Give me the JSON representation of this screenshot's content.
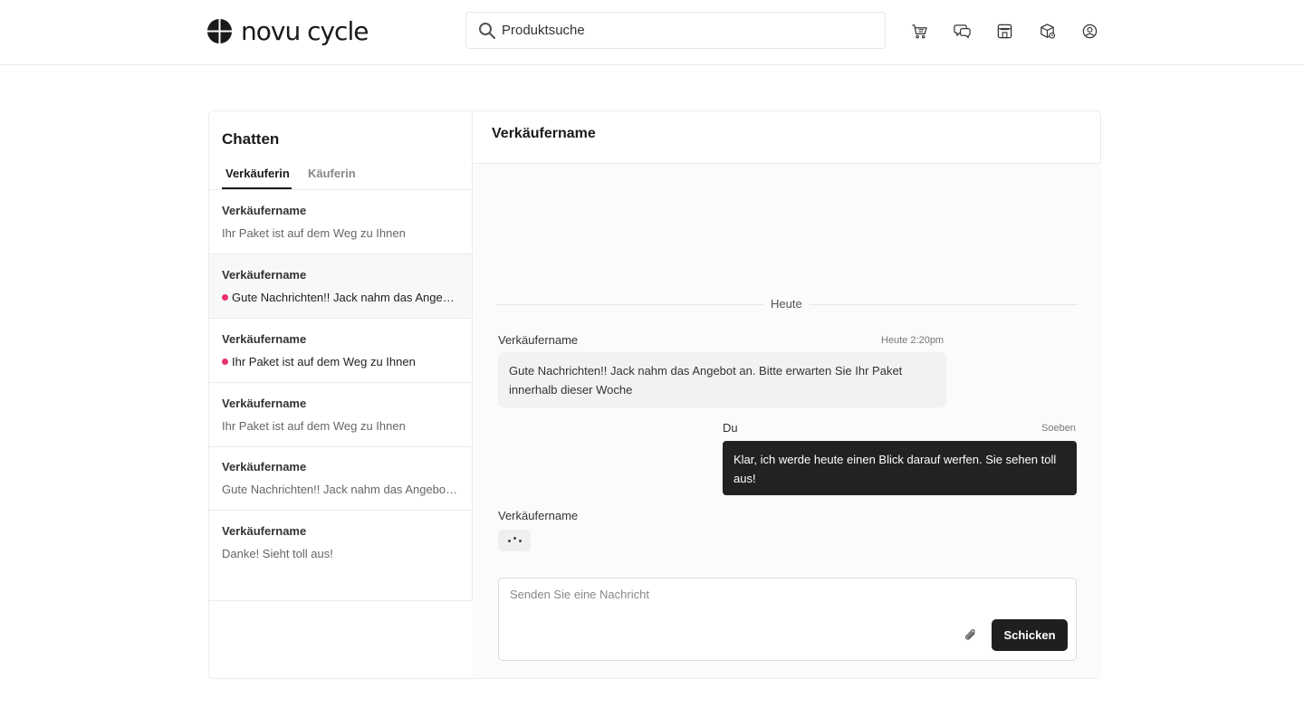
{
  "header": {
    "brand": "novu cycle",
    "search_placeholder": "Produktsuche",
    "icons": [
      "cart-icon",
      "chat-icon",
      "store-icon",
      "package-icon",
      "user-icon"
    ]
  },
  "sidebar": {
    "title": "Chatten",
    "tabs": [
      {
        "label": "Verkäuferin",
        "active": true
      },
      {
        "label": "Käuferin",
        "active": false
      }
    ],
    "conversations": [
      {
        "name": "Verkäufername",
        "message": "Ihr Paket ist auf dem Weg zu Ihnen",
        "unread": false
      },
      {
        "name": "Verkäufername",
        "message": "Gute Nachrichten!! Jack nahm das Angebot an. Bitte erwarten Sie Ihr Paket innerhalb dieser Woche",
        "unread": true
      },
      {
        "name": "Verkäufername",
        "message": "Ihr Paket ist auf dem Weg zu Ihnen",
        "unread": true
      },
      {
        "name": "Verkäufername",
        "message": "Ihr Paket ist auf dem Weg zu Ihnen",
        "unread": false
      },
      {
        "name": "Verkäufername",
        "message": "Gute Nachrichten!! Jack nahm das Angebot an. Bitte erwarten Sie Ihr Paket innerhalb dieser Woche",
        "unread": false
      },
      {
        "name": "Verkäufername",
        "message": "Danke! Sieht toll aus!",
        "unread": false
      }
    ]
  },
  "chat": {
    "title": "Verkäufername",
    "day_divider": "Heute",
    "messages": [
      {
        "sender": "Verkäufername",
        "time": "Heute 2:20pm",
        "text": "Gute Nachrichten!! Jack nahm das Angebot an. Bitte erwarten Sie Ihr Paket innerhalb dieser Woche"
      },
      {
        "sender": "Du",
        "time": "Soeben",
        "text": "Klar, ich werde heute einen Blick darauf werfen. Sie sehen toll aus!"
      }
    ],
    "typing_sender": "Verkäufername",
    "composer": {
      "placeholder": "Senden Sie eine Nachricht",
      "value": "",
      "send_label": "Schicken"
    }
  },
  "colors": {
    "unread_dot": "#e8336b",
    "primary_dark": "#1f1f1f"
  }
}
